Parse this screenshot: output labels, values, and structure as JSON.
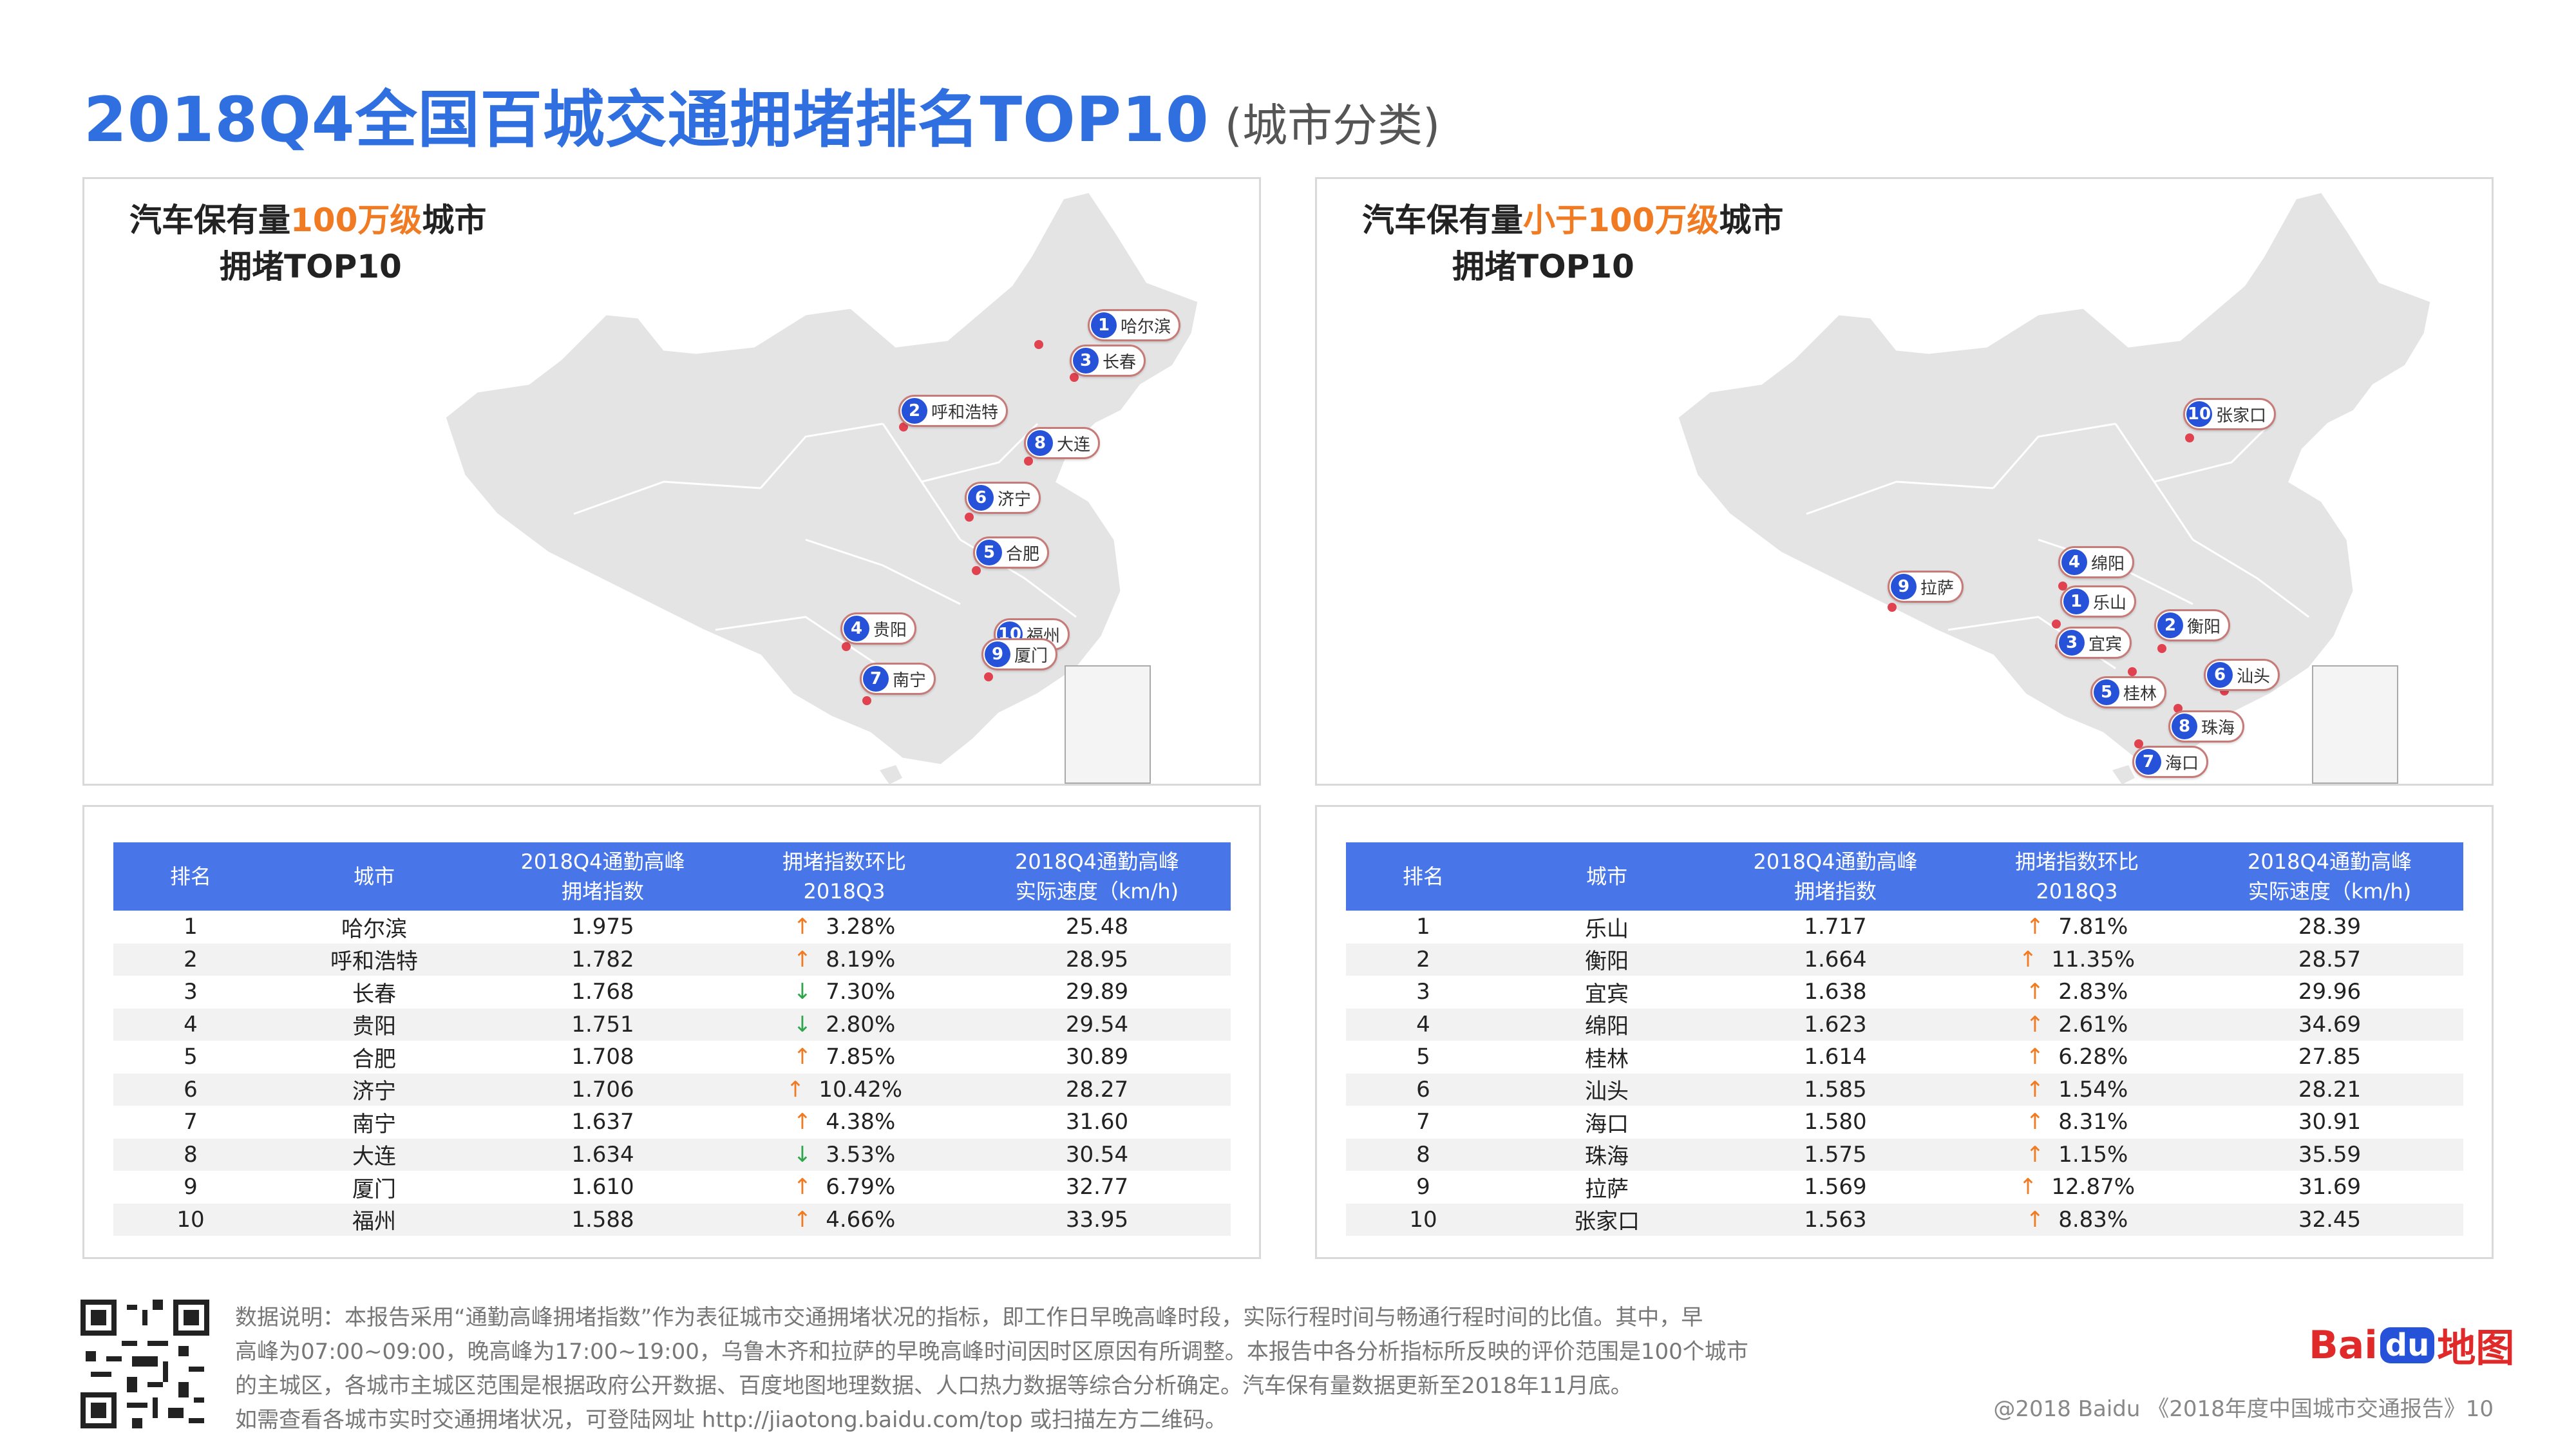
{
  "title": {
    "main": "2018Q4全国百城交通拥堵排名TOP10",
    "sub": "(城市分类)"
  },
  "panels": [
    {
      "head_pre": "汽车保有量",
      "head_hl": "100万级",
      "head_post": "城市",
      "head_line2": "拥堵TOP10",
      "markers": [
        {
          "rank": "1",
          "city": "哈尔滨"
        },
        {
          "rank": "3",
          "city": "长春"
        },
        {
          "rank": "2",
          "city": "呼和浩特"
        },
        {
          "rank": "8",
          "city": "大连"
        },
        {
          "rank": "6",
          "city": "济宁"
        },
        {
          "rank": "5",
          "city": "合肥"
        },
        {
          "rank": "4",
          "city": "贵阳"
        },
        {
          "rank": "10",
          "city": "福州"
        },
        {
          "rank": "9",
          "city": "厦门"
        },
        {
          "rank": "7",
          "city": "南宁"
        }
      ],
      "table": {
        "headers": [
          "排名",
          "城市",
          "2018Q4通勤高峰\n拥堵指数",
          "拥堵指数环比\n2018Q3",
          "2018Q4通勤高峰\n实际速度（km/h)"
        ],
        "rows": [
          {
            "rank": "1",
            "city": "哈尔滨",
            "index": "1.975",
            "dir": "up",
            "change": "3.28%",
            "speed": "25.48"
          },
          {
            "rank": "2",
            "city": "呼和浩特",
            "index": "1.782",
            "dir": "up",
            "change": "8.19%",
            "speed": "28.95"
          },
          {
            "rank": "3",
            "city": "长春",
            "index": "1.768",
            "dir": "down",
            "change": "7.30%",
            "speed": "29.89"
          },
          {
            "rank": "4",
            "city": "贵阳",
            "index": "1.751",
            "dir": "down",
            "change": "2.80%",
            "speed": "29.54"
          },
          {
            "rank": "5",
            "city": "合肥",
            "index": "1.708",
            "dir": "up",
            "change": "7.85%",
            "speed": "30.89"
          },
          {
            "rank": "6",
            "city": "济宁",
            "index": "1.706",
            "dir": "up",
            "change": "10.42%",
            "speed": "28.27"
          },
          {
            "rank": "7",
            "city": "南宁",
            "index": "1.637",
            "dir": "up",
            "change": "4.38%",
            "speed": "31.60"
          },
          {
            "rank": "8",
            "city": "大连",
            "index": "1.634",
            "dir": "down",
            "change": "3.53%",
            "speed": "30.54"
          },
          {
            "rank": "9",
            "city": "厦门",
            "index": "1.610",
            "dir": "up",
            "change": "6.79%",
            "speed": "32.77"
          },
          {
            "rank": "10",
            "city": "福州",
            "index": "1.588",
            "dir": "up",
            "change": "4.66%",
            "speed": "33.95"
          }
        ]
      }
    },
    {
      "head_pre": "汽车保有量",
      "head_hl": "小于100万级",
      "head_post": "城市",
      "head_line2": "拥堵TOP10",
      "markers": [
        {
          "rank": "10",
          "city": "张家口"
        },
        {
          "rank": "4",
          "city": "绵阳"
        },
        {
          "rank": "9",
          "city": "拉萨"
        },
        {
          "rank": "1",
          "city": "乐山"
        },
        {
          "rank": "2",
          "city": "衡阳"
        },
        {
          "rank": "3",
          "city": "宜宾"
        },
        {
          "rank": "6",
          "city": "汕头"
        },
        {
          "rank": "5",
          "city": "桂林"
        },
        {
          "rank": "8",
          "city": "珠海"
        },
        {
          "rank": "7",
          "city": "海口"
        }
      ],
      "table": {
        "headers": [
          "排名",
          "城市",
          "2018Q4通勤高峰\n拥堵指数",
          "拥堵指数环比\n2018Q3",
          "2018Q4通勤高峰\n实际速度（km/h)"
        ],
        "rows": [
          {
            "rank": "1",
            "city": "乐山",
            "index": "1.717",
            "dir": "up",
            "change": "7.81%",
            "speed": "28.39"
          },
          {
            "rank": "2",
            "city": "衡阳",
            "index": "1.664",
            "dir": "up",
            "change": "11.35%",
            "speed": "28.57"
          },
          {
            "rank": "3",
            "city": "宜宾",
            "index": "1.638",
            "dir": "up",
            "change": "2.83%",
            "speed": "29.96"
          },
          {
            "rank": "4",
            "city": "绵阳",
            "index": "1.623",
            "dir": "up",
            "change": "2.61%",
            "speed": "34.69"
          },
          {
            "rank": "5",
            "city": "桂林",
            "index": "1.614",
            "dir": "up",
            "change": "6.28%",
            "speed": "27.85"
          },
          {
            "rank": "6",
            "city": "汕头",
            "index": "1.585",
            "dir": "up",
            "change": "1.54%",
            "speed": "28.21"
          },
          {
            "rank": "7",
            "city": "海口",
            "index": "1.580",
            "dir": "up",
            "change": "8.31%",
            "speed": "30.91"
          },
          {
            "rank": "8",
            "city": "珠海",
            "index": "1.575",
            "dir": "up",
            "change": "1.15%",
            "speed": "35.59"
          },
          {
            "rank": "9",
            "city": "拉萨",
            "index": "1.569",
            "dir": "up",
            "change": "12.87%",
            "speed": "31.69"
          },
          {
            "rank": "10",
            "city": "张家口",
            "index": "1.563",
            "dir": "up",
            "change": "8.83%",
            "speed": "32.45"
          }
        ]
      }
    }
  ],
  "arrows": {
    "up": "↑",
    "down": "↓"
  },
  "colors": {
    "accent": "#2f6fe0",
    "header": "#4876e8",
    "highlight": "#f07b22",
    "up": "#f07b22",
    "down": "#2fa64c",
    "marker_num": "#2552d8",
    "city_dot": "#e0424f"
  },
  "footer": {
    "note_lines": [
      "数据说明：本报告采用“通勤高峰拥堵指数”作为表征城市交通拥堵状况的指标，即工作日早晚高峰时段，实际行程时间与畅通行程时间的比值。其中，早",
      "高峰为07:00~09:00，晚高峰为17:00~19:00，乌鲁木齐和拉萨的早晚高峰时间因时区原因有所调整。本报告中各分析指标所反映的评价范围是100个城市",
      "的主城区，各城市主城区范围是根据政府公开数据、百度地图地理数据、人口热力数据等综合分析确定。汽车保有量数据更新至2018年11月底。",
      "如需查看各城市实时交通拥堵状况，可登陆网址 http://jiaotong.baidu.com/top 或扫描左方二维码。"
    ],
    "logo_pre": "Bai",
    "logo_du": "du",
    "logo_post": "地图",
    "copyright": "@2018 Baidu 《2018年度中国城市交通报告》10"
  }
}
